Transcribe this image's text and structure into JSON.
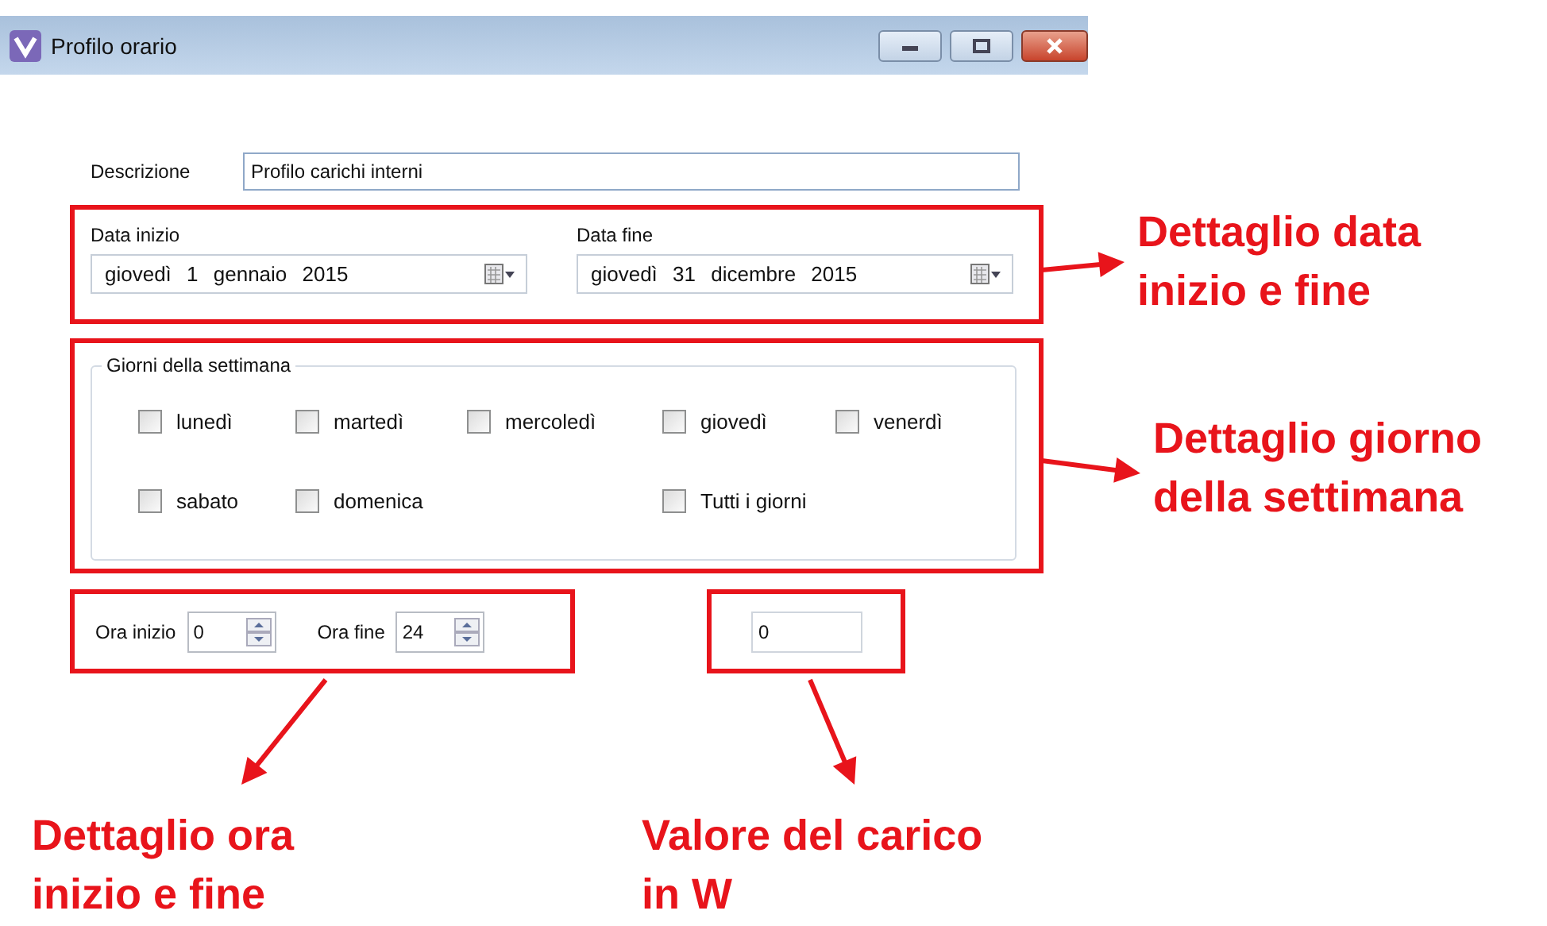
{
  "window": {
    "title": "Profilo orario"
  },
  "description": {
    "label": "Descrizione",
    "value": "Profilo carichi interni"
  },
  "dates": [
    {
      "label": "Data inizio",
      "value": "giovedì 1 gennaio 2015"
    },
    {
      "label": "Data fine",
      "value": "giovedì 31 dicembre 2015"
    }
  ],
  "weekdays": {
    "title": "Giorni della settimana",
    "items": [
      {
        "label": "lunedì",
        "kind": "day",
        "checked": false
      },
      {
        "label": "martedì",
        "kind": "day",
        "checked": false
      },
      {
        "label": "mercoledì",
        "kind": "day",
        "checked": false
      },
      {
        "label": "giovedì",
        "kind": "day",
        "checked": false
      },
      {
        "label": "venerdì",
        "kind": "day",
        "checked": false
      },
      {
        "label": "sabato",
        "kind": "day",
        "checked": false
      },
      {
        "label": "domenica",
        "kind": "day",
        "checked": false
      },
      {
        "label": "Tutti i giorni",
        "kind": "all",
        "checked": false
      }
    ]
  },
  "hours": [
    {
      "label": "Ora inizio",
      "value": "0"
    },
    {
      "label": "Ora fine",
      "value": "24"
    }
  ],
  "load": {
    "value": "0"
  },
  "callouts": [
    {
      "lines": [
        "Dettaglio data",
        "inizio e fine"
      ]
    },
    {
      "lines": [
        "Dettaglio giorno",
        "della settimana"
      ]
    },
    {
      "lines": [
        "Dettaglio ora",
        "inizio e fine"
      ]
    },
    {
      "lines": [
        "Valore del carico",
        "in W"
      ]
    }
  ]
}
